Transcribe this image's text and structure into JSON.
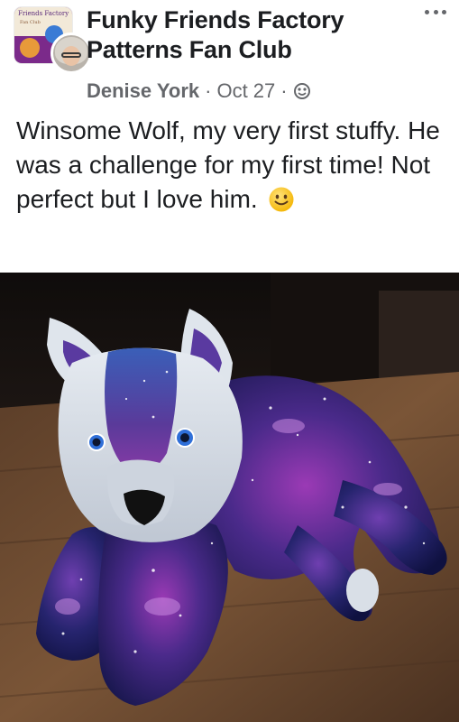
{
  "group": {
    "name": "Funky Friends Factory Patterns Fan Club",
    "thumb_text": "Friends Factory",
    "thumb_subtext": "Fan Club"
  },
  "post": {
    "author": "Denise York",
    "date": "Oct 27",
    "separator": "·",
    "audience_icon": "globe-icon",
    "text": "Winsome Wolf, my very first stuffy.  He was a challenge for my first time! Not perfect but I love him.",
    "emoji": "smiley-icon"
  },
  "photo": {
    "subject": "handmade galaxy fabric wolf plush on wooden table"
  },
  "colors": {
    "text_primary": "#1c1e21",
    "text_secondary": "#65676b",
    "galaxy_navy": "#1b1d5c",
    "galaxy_purple": "#8a3aa6",
    "wolf_face": "#d7dde6",
    "table_wood": "#6b4a31"
  }
}
